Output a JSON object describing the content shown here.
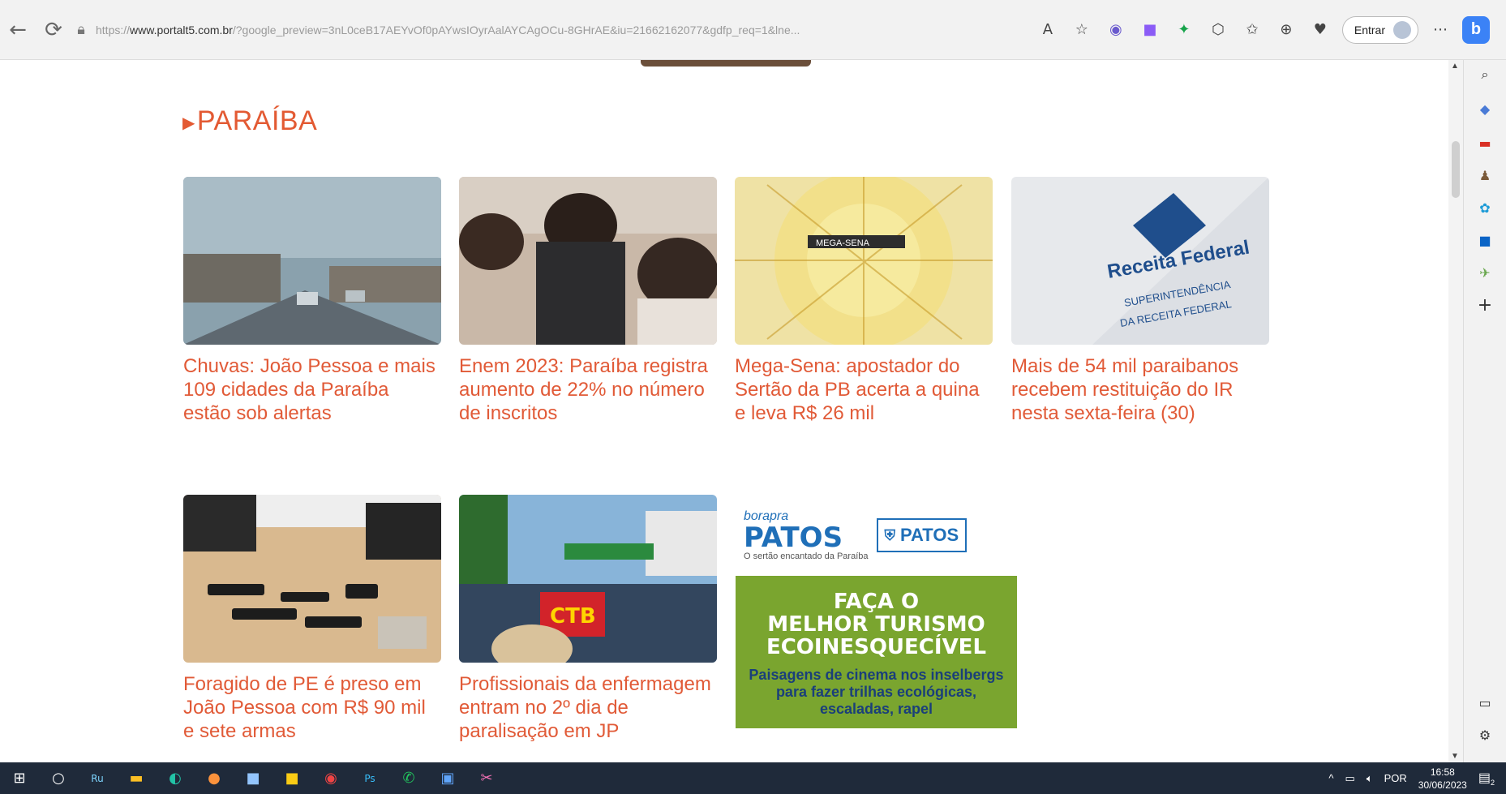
{
  "browser": {
    "url_prefix": "https://",
    "url_host": "www.portalt5.com.br",
    "url_rest": "/?google_preview=3nL0ceB17AEYvOf0pAYwsIOyrAalAYCAgOCu-8GHrAE&iu=21662162077&gdfp_req=1&lne...",
    "entrar_label": "Entrar"
  },
  "page": {
    "section_title": "PARAÍBA",
    "articles": [
      {
        "title": "Chuvas: João Pessoa e mais 109 cidades da Paraíba estão sob alertas"
      },
      {
        "title": "Enem 2023: Paraíba registra aumento de 22% no número de inscritos"
      },
      {
        "title": "Mega-Sena: apostador do Sertão da PB acerta a quina e leva R$ 26 mil"
      },
      {
        "title": "Mais de 54 mil paraibanos recebem restituição do IR nesta sexta-feira (30)"
      },
      {
        "title": "Foragido de PE é preso em João Pessoa com R$ 90 mil e sete armas"
      },
      {
        "title": "Profissionais da enfermagem entram no 2º dia de paralisação em JP"
      }
    ],
    "image_texts": {
      "receita_line1": "Receita Federal",
      "receita_line2": "SUPERINTENDÊNCIA",
      "receita_line3": "DA RECEITA FEDERAL",
      "ctb": "CTB",
      "megasena": "MEGA-SENA"
    },
    "ad": {
      "brand_small": "borapra",
      "brand": "PATOS",
      "tagline": "O sertão encantado da Paraíba",
      "city": "PATOS",
      "headline1": "FAÇA O",
      "headline2": "MELHOR TURISMO",
      "headline3": "ECOINESQUECÍVEL",
      "sub": "Paisagens de cinema nos inselbergs para fazer trilhas ecológicas, escaladas, rapel"
    }
  },
  "taskbar": {
    "lang": "POR",
    "time": "16:58",
    "date": "30/06/2023",
    "notif_count": "2"
  },
  "colors": {
    "accent": "#e35a33",
    "ad_green": "#7aa52f",
    "ad_blue": "#1f6fb8",
    "taskbar": "#1f2a3a"
  }
}
